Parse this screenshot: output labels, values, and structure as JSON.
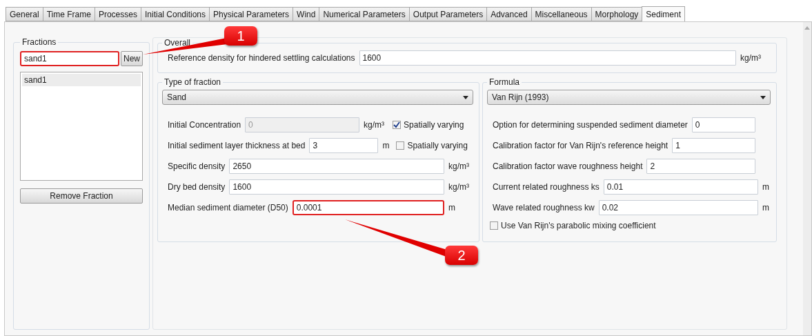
{
  "tabs": [
    {
      "label": "General",
      "selected": false
    },
    {
      "label": "Time Frame",
      "selected": false
    },
    {
      "label": "Processes",
      "selected": false
    },
    {
      "label": "Initial Conditions",
      "selected": false
    },
    {
      "label": "Physical Parameters",
      "selected": false
    },
    {
      "label": "Wind",
      "selected": false
    },
    {
      "label": "Numerical Parameters",
      "selected": false
    },
    {
      "label": "Output Parameters",
      "selected": false
    },
    {
      "label": "Advanced",
      "selected": false
    },
    {
      "label": "Miscellaneous",
      "selected": false
    },
    {
      "label": "Morphology",
      "selected": false
    },
    {
      "label": "Sediment",
      "selected": true
    }
  ],
  "fractions": {
    "title": "Fractions",
    "name_field": {
      "value": "sand1",
      "highlighted": true
    },
    "new_button": "New",
    "list": [
      {
        "label": "sand1",
        "selected": true
      }
    ],
    "remove_button": "Remove Fraction"
  },
  "overall": {
    "title": "Overall",
    "rows": [
      {
        "label": "Reference density for hindered settling calculations",
        "value": "1600",
        "unit": "kg/m³",
        "disabled": false,
        "highlighted": false
      }
    ]
  },
  "type_of_fraction": {
    "title": "Type of fraction",
    "dropdown": "Sand",
    "rows": [
      {
        "label": "Initial Concentration",
        "value": "0",
        "unit": "kg/m³",
        "disabled": true,
        "highlighted": false,
        "checkbox": {
          "label": "Spatially varying",
          "checked": true
        }
      },
      {
        "label": "Initial sediment layer thickness at bed",
        "value": "3",
        "unit": "m",
        "disabled": false,
        "highlighted": false,
        "checkbox": {
          "label": "Spatially varying",
          "checked": false
        }
      },
      {
        "label": "Specific density",
        "value": "2650",
        "unit": "kg/m³",
        "disabled": false,
        "highlighted": false
      },
      {
        "label": "Dry bed density",
        "value": "1600",
        "unit": "kg/m³",
        "disabled": false,
        "highlighted": false
      },
      {
        "label": "Median sediment diameter (D50)",
        "value": "0.0001",
        "unit": "m",
        "disabled": false,
        "highlighted": true
      }
    ]
  },
  "formula": {
    "title": "Formula",
    "dropdown": "Van Rijn (1993)",
    "rows": [
      {
        "label": "Option for determining suspended sediment diameter",
        "value": "0",
        "disabled": false,
        "highlighted": false
      },
      {
        "label": "Calibration factor for Van Rijn's reference height",
        "value": "1",
        "disabled": false,
        "highlighted": false
      },
      {
        "label": "Calibration factor wave roughness height",
        "value": "2",
        "disabled": false,
        "highlighted": false
      },
      {
        "label": "Current related roughness ks",
        "value": "0.01",
        "unit": "m",
        "disabled": false,
        "highlighted": false
      },
      {
        "label": "Wave related roughness kw",
        "value": "0.02",
        "unit": "m",
        "disabled": false,
        "highlighted": false
      }
    ],
    "checkbox": {
      "label": "Use Van Rijn's parabolic mixing coefficient",
      "checked": false
    }
  },
  "callouts": [
    {
      "label": "1"
    },
    {
      "label": "2"
    }
  ]
}
